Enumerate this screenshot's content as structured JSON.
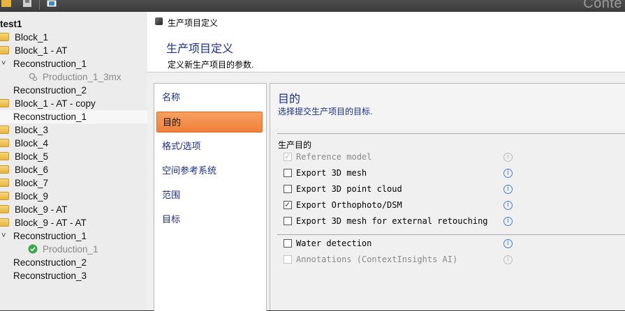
{
  "app": {
    "title": "Conte"
  },
  "tree": [
    {
      "label": "test1",
      "kind": "root",
      "expanded": null,
      "selected": false
    },
    {
      "label": "Block_1",
      "kind": "block"
    },
    {
      "label": "Block_1 - AT",
      "kind": "block"
    },
    {
      "label": "Reconstruction_1",
      "kind": "reconstruction",
      "expanded": true
    },
    {
      "label": "Production_1_3mx",
      "kind": "production",
      "status": "gear"
    },
    {
      "label": "Reconstruction_2",
      "kind": "reconstruction"
    },
    {
      "label": "Block_1 - AT - copy",
      "kind": "block"
    },
    {
      "label": "Reconstruction_1",
      "kind": "reconstruction",
      "selected": true
    },
    {
      "label": "Block_3",
      "kind": "block"
    },
    {
      "label": "Block_4",
      "kind": "block"
    },
    {
      "label": "Block_5",
      "kind": "block"
    },
    {
      "label": "Block_6",
      "kind": "block"
    },
    {
      "label": "Block_7",
      "kind": "block"
    },
    {
      "label": "Block_9",
      "kind": "block"
    },
    {
      "label": "Block_9 - AT",
      "kind": "block"
    },
    {
      "label": "Block_9 - AT - AT",
      "kind": "block"
    },
    {
      "label": "Reconstruction_1",
      "kind": "reconstruction",
      "expanded": true
    },
    {
      "label": "Production_1",
      "kind": "production",
      "status": "ok"
    },
    {
      "label": "Reconstruction_2",
      "kind": "reconstruction"
    },
    {
      "label": "Reconstruction_3",
      "kind": "reconstruction"
    }
  ],
  "dialog": {
    "window_title": "生产项目定义",
    "heading": "生产项目定义",
    "subheading": "定义新生产项目的参数.",
    "nav": [
      "名称",
      "目的",
      "格式/选项",
      "空间参考系统",
      "范围",
      "目标"
    ],
    "nav_active": "目的",
    "section_title": "目的",
    "section_desc": "选择提交生产项目的目标.",
    "group_label": "生产目的",
    "options": [
      {
        "label": "Reference model",
        "checked": true,
        "disabled": true
      },
      {
        "label": "Export 3D mesh",
        "checked": false,
        "disabled": false
      },
      {
        "label": "Export 3D point cloud",
        "checked": false,
        "disabled": false
      },
      {
        "label": "Export Orthophoto/DSM",
        "checked": true,
        "disabled": false
      },
      {
        "label": "Export 3D mesh for external retouching",
        "checked": false,
        "disabled": false
      },
      {
        "label": "Water detection",
        "checked": false,
        "disabled": false
      },
      {
        "label": "Annotations (ContextInsights AI)",
        "checked": false,
        "disabled": true
      }
    ]
  },
  "colors": {
    "accent": "#f0803a",
    "link": "#1a2f8a",
    "info": "#4a7fd0"
  }
}
